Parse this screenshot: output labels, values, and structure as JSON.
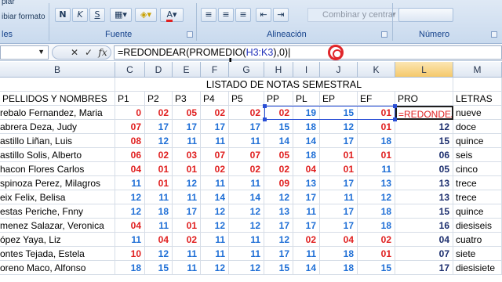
{
  "ribbon": {
    "clipboard_items": [
      "piar",
      "ibiar formato"
    ],
    "clipboard_group": "les",
    "font_group": "Fuente",
    "align_group": "Alineación",
    "number_group": "Número",
    "bold": "N",
    "italic": "K",
    "underline": "S",
    "merge_label": "Combinar y centrar",
    "font_color_letter": "A"
  },
  "formula_bar": {
    "formula_prefix": "=REDONDEAR(PROMEDIO(",
    "formula_ref": "H3:K3",
    "formula_suffix": "),0)",
    "cancel": "✕",
    "enter": "✓",
    "fx": "fx"
  },
  "columns": [
    "B",
    "C",
    "D",
    "E",
    "F",
    "G",
    "H",
    "I",
    "J",
    "K",
    "L",
    "M"
  ],
  "active_column": "L",
  "title": "LISTADO DE NOTAS SEMESTRAL",
  "headers": [
    "PELLIDOS Y NOMBRES",
    "P1",
    "P2",
    "P3",
    "P4",
    "P5",
    "PP",
    "PL",
    "EP",
    "EF",
    "PRO",
    "LETRAS"
  ],
  "editing_text": "=REDONDEA",
  "rows": [
    {
      "name": "rebalo Fernandez, Maria",
      "vals": [
        "0",
        "02",
        "05",
        "02",
        "02",
        "02",
        "19",
        "15",
        "01"
      ],
      "pro": "",
      "letras": "nueve"
    },
    {
      "name": "abrera Deza, Judy",
      "vals": [
        "07",
        "17",
        "17",
        "17",
        "17",
        "15",
        "18",
        "12",
        "01"
      ],
      "pro": "12",
      "letras": "doce"
    },
    {
      "name": "astillo Liñan, Luis",
      "vals": [
        "08",
        "12",
        "11",
        "11",
        "11",
        "14",
        "14",
        "17",
        "18"
      ],
      "pro": "15",
      "letras": "quince"
    },
    {
      "name": "astillo Solis, Alberto",
      "vals": [
        "06",
        "02",
        "03",
        "07",
        "07",
        "05",
        "18",
        "01",
        "01"
      ],
      "pro": "06",
      "letras": "seis"
    },
    {
      "name": "hacon Flores Carlos",
      "vals": [
        "04",
        "01",
        "01",
        "02",
        "02",
        "02",
        "04",
        "01",
        "11"
      ],
      "pro": "05",
      "letras": "cinco"
    },
    {
      "name": "spinoza Perez, Milagros",
      "vals": [
        "11",
        "01",
        "12",
        "11",
        "11",
        "09",
        "13",
        "17",
        "13"
      ],
      "pro": "13",
      "letras": "trece"
    },
    {
      "name": "eix Felix, Belisa",
      "vals": [
        "12",
        "11",
        "11",
        "14",
        "14",
        "12",
        "17",
        "11",
        "12"
      ],
      "pro": "13",
      "letras": "trece"
    },
    {
      "name": "estas Periche, Fnny",
      "vals": [
        "12",
        "18",
        "17",
        "12",
        "12",
        "13",
        "11",
        "17",
        "18"
      ],
      "pro": "15",
      "letras": "quince"
    },
    {
      "name": "menez Salazar, Veronica",
      "vals": [
        "04",
        "11",
        "01",
        "12",
        "12",
        "17",
        "17",
        "17",
        "18"
      ],
      "pro": "16",
      "letras": "diesiseis"
    },
    {
      "name": "ópez Yaya, Liz",
      "vals": [
        "11",
        "04",
        "02",
        "11",
        "11",
        "12",
        "02",
        "04",
        "02"
      ],
      "pro": "04",
      "letras": "cuatro"
    },
    {
      "name": "ontes Tejada, Estela",
      "vals": [
        "10",
        "12",
        "11",
        "11",
        "11",
        "17",
        "11",
        "18",
        "01"
      ],
      "pro": "07",
      "letras": "siete"
    },
    {
      "name": "oreno Maco, Alfonso",
      "vals": [
        "18",
        "15",
        "11",
        "12",
        "12",
        "15",
        "14",
        "18",
        "15"
      ],
      "pro": "17",
      "letras": "diesisiete"
    }
  ]
}
